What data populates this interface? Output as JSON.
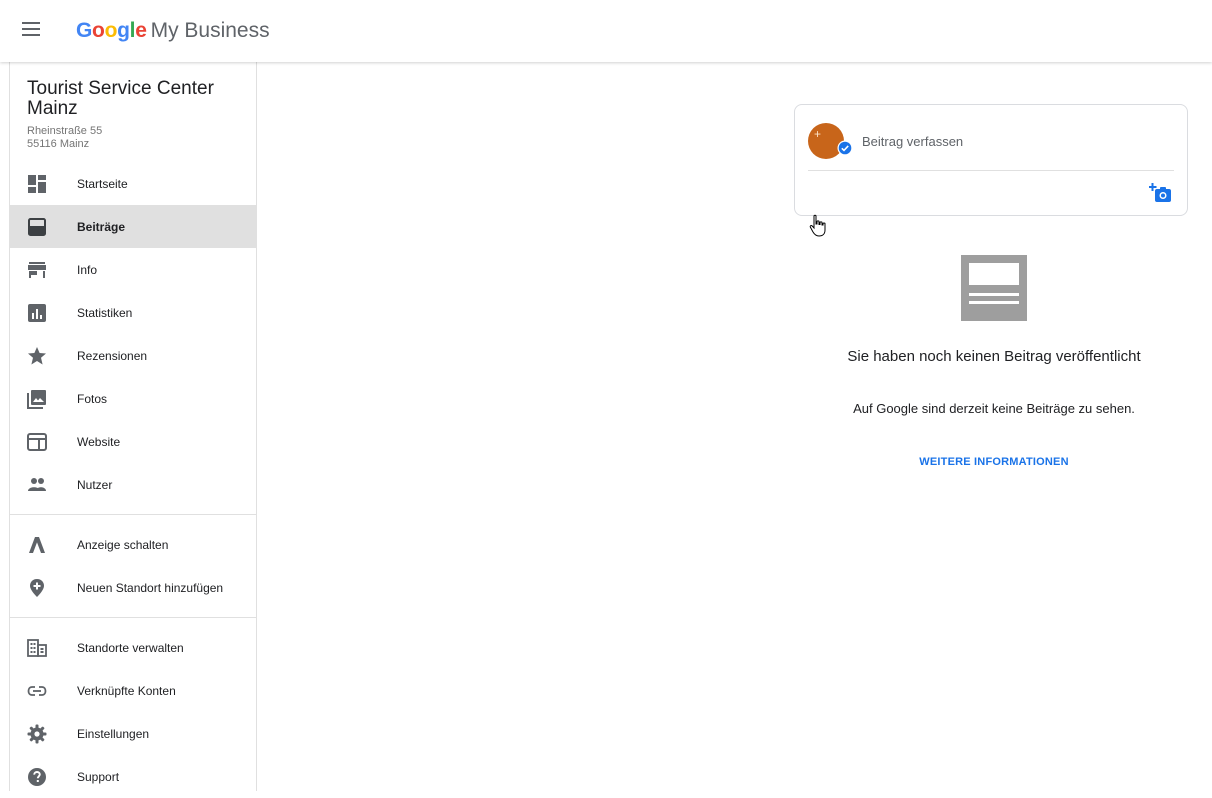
{
  "header": {
    "logo_text": "Google",
    "product": "My Business"
  },
  "business": {
    "name": "Tourist Service Center Mainz",
    "address_line1": "Rheinstraße 55",
    "address_line2": "55116 Mainz"
  },
  "nav": {
    "main": [
      {
        "label": "Startseite",
        "icon": "dashboard-icon"
      },
      {
        "label": "Beiträge",
        "icon": "posts-icon",
        "active": true
      },
      {
        "label": "Info",
        "icon": "store-icon"
      },
      {
        "label": "Statistiken",
        "icon": "insights-icon"
      },
      {
        "label": "Rezensionen",
        "icon": "star-icon"
      },
      {
        "label": "Fotos",
        "icon": "photos-icon"
      },
      {
        "label": "Website",
        "icon": "website-icon"
      },
      {
        "label": "Nutzer",
        "icon": "users-icon"
      }
    ],
    "secondary": [
      {
        "label": "Anzeige schalten",
        "icon": "google-ads-icon"
      },
      {
        "label": "Neuen Standort hinzufügen",
        "icon": "add-location-icon"
      }
    ],
    "tertiary": [
      {
        "label": "Standorte verwalten",
        "icon": "manage-locations-icon"
      },
      {
        "label": "Verknüpfte Konten",
        "icon": "link-icon"
      },
      {
        "label": "Einstellungen",
        "icon": "gear-icon"
      },
      {
        "label": "Support",
        "icon": "help-icon"
      }
    ]
  },
  "compose": {
    "placeholder": "Beitrag verfassen"
  },
  "empty_state": {
    "title": "Sie haben noch keinen Beitrag veröffentlicht",
    "subtitle": "Auf Google sind derzeit keine Beiträge zu sehen.",
    "link": "WEITERE INFORMATIONEN"
  },
  "colors": {
    "accent": "#1a73e8",
    "active_bg": "#e0e0e0",
    "icon": "#5f6368",
    "avatar": "#c8651a"
  }
}
